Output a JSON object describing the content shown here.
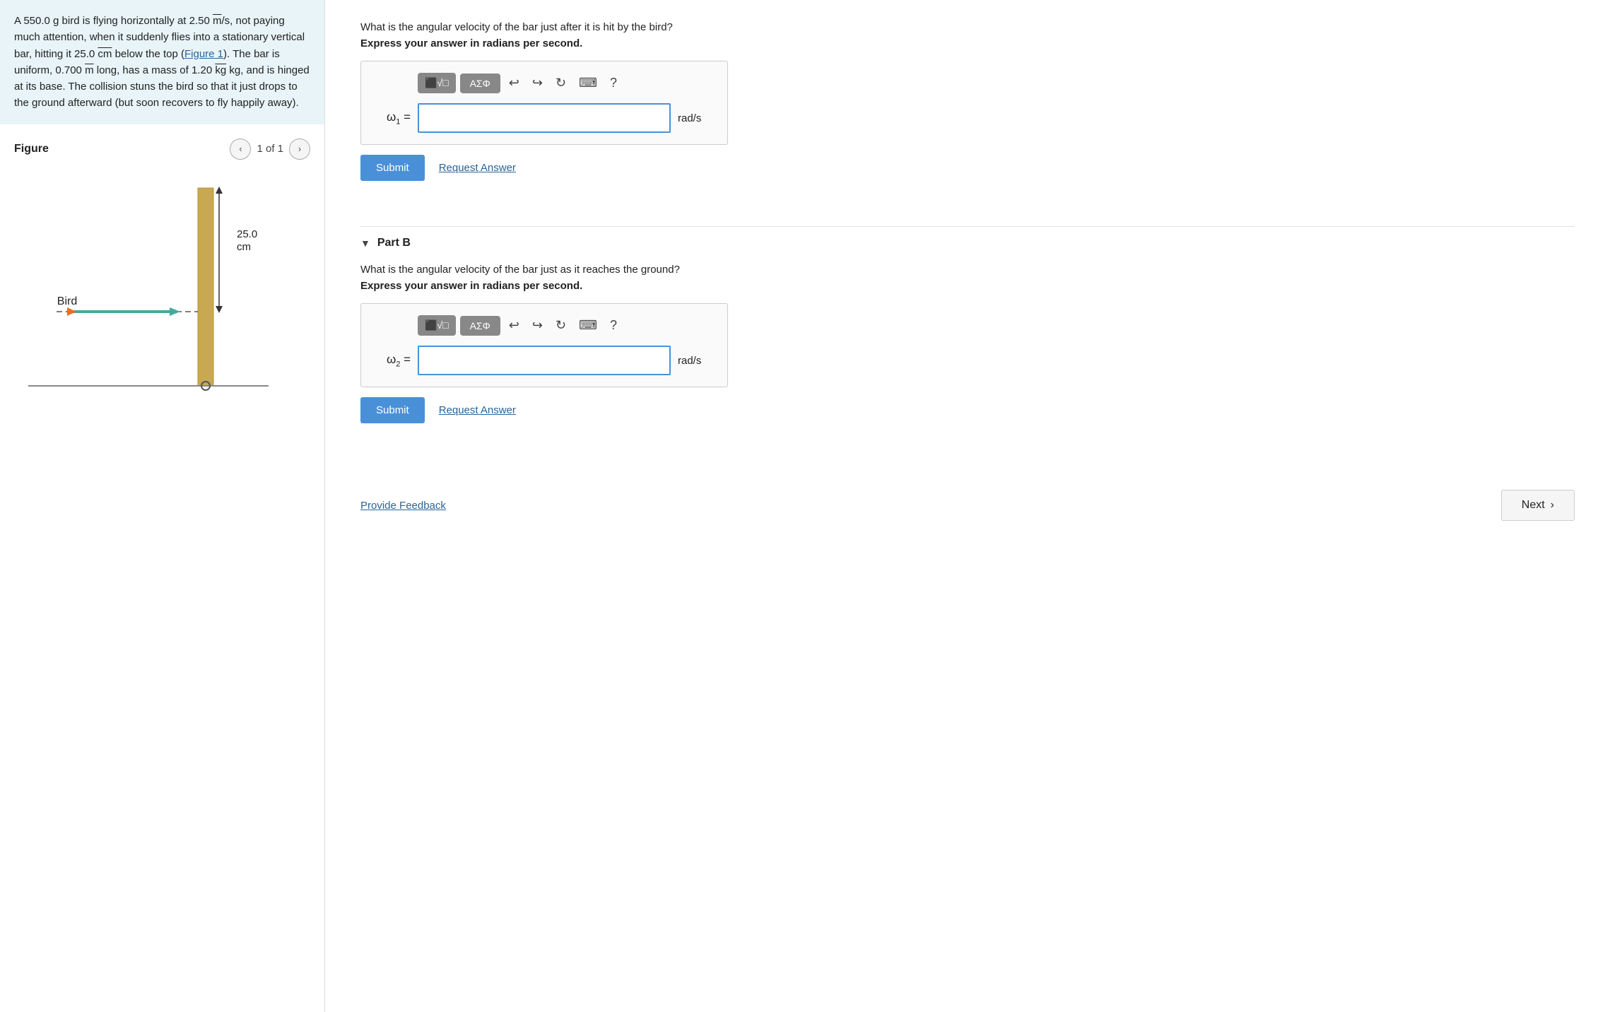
{
  "problem": {
    "text": "A 550.0 g bird is flying horizontally at 2.50 m/s, not paying much attention, when it suddenly flies into a stationary vertical bar, hitting it 25.0 cm below the top (Figure 1). The bar is uniform, 0.700 m long, has a mass of 1.20 kg kg, and is hinged at its base. The collision stuns the bird so that it just drops to the ground afterward (but soon recovers to fly happily away).",
    "figure_link": "Figure 1"
  },
  "partA": {
    "question": "What is the angular velocity of the bar just after it is hit by the bird?",
    "express_label": "Express your answer in radians per second.",
    "omega_label": "ω₁ =",
    "unit": "rad/s",
    "submit_label": "Submit",
    "request_answer_label": "Request Answer"
  },
  "partB": {
    "collapse_symbol": "▼",
    "part_label": "Part B",
    "question": "What is the angular velocity of the bar just as it reaches the ground?",
    "express_label": "Express your answer in radians per second.",
    "omega_label": "ω₂ =",
    "unit": "rad/s",
    "submit_label": "Submit",
    "request_answer_label": "Request Answer"
  },
  "figure": {
    "title": "Figure",
    "page": "1 of 1",
    "prev_label": "‹",
    "next_label": "›",
    "label_bird": "Bird",
    "label_distance": "25.0",
    "label_cm": "cm"
  },
  "footer": {
    "provide_feedback_label": "Provide Feedback",
    "next_label": "Next"
  },
  "toolbar": {
    "btn1_label": "⬛√□",
    "btn2_label": "ΑΣΦ",
    "undo_symbol": "↩",
    "redo_symbol": "↪",
    "refresh_symbol": "↻",
    "keyboard_symbol": "⌨",
    "help_symbol": "?"
  }
}
